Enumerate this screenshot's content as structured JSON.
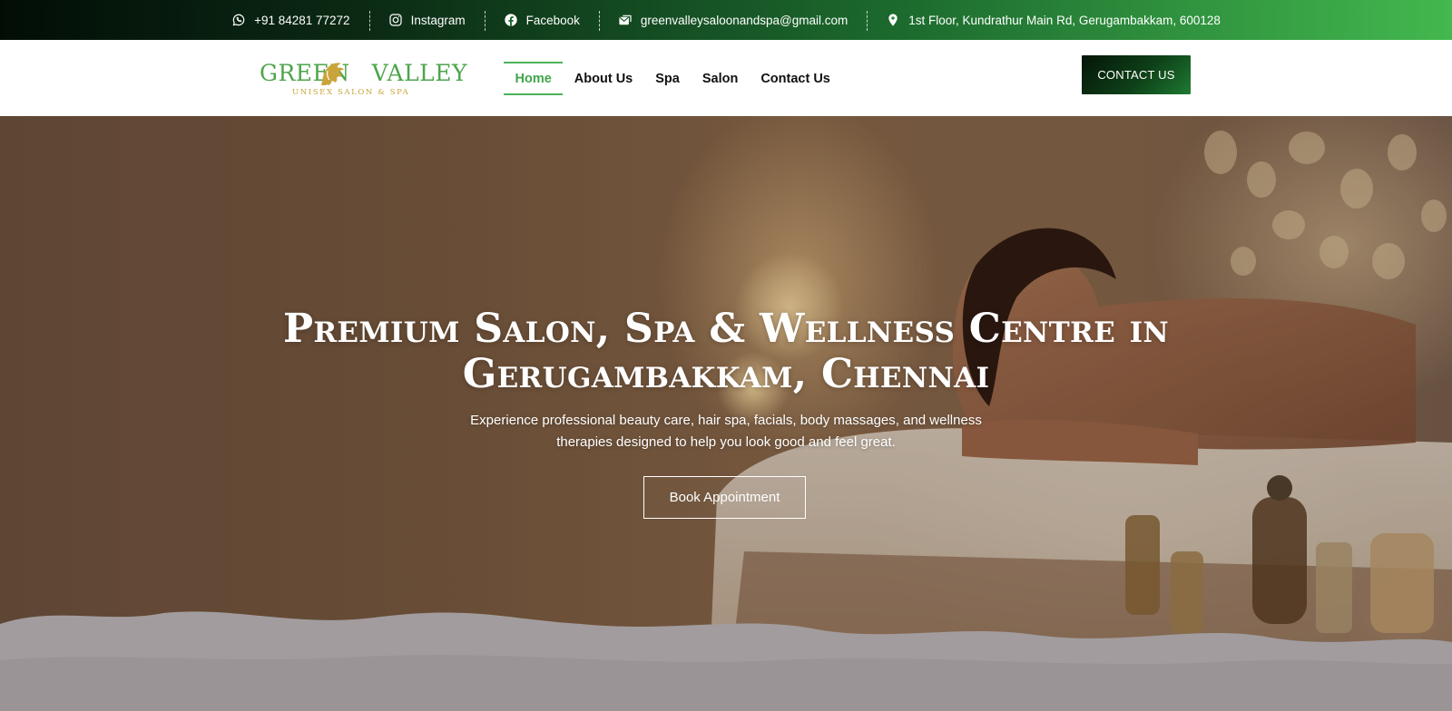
{
  "topbar": {
    "items": [
      {
        "icon": "whatsapp-icon",
        "text": "+91 84281 77272"
      },
      {
        "icon": "instagram-icon",
        "text": "Instagram"
      },
      {
        "icon": "facebook-icon",
        "text": "Facebook"
      },
      {
        "icon": "mail-icon",
        "text": "greenvalleysaloonandspa@gmail.com"
      },
      {
        "icon": "location-pin-icon",
        "text": "1st Floor, Kundrathur Main Rd, Gerugambakkam, 600128"
      }
    ]
  },
  "logo": {
    "brand": "GREEN VALLEY",
    "tagline": "UNISEX SALON & SPA",
    "green": "#4ea54b",
    "gold": "#c9a43a"
  },
  "nav": {
    "items": [
      "Home",
      "About Us",
      "Spa",
      "Salon",
      "Contact Us"
    ],
    "active": "Home",
    "active_color": "#3fa64a"
  },
  "header_cta": {
    "label": "CONTACT US"
  },
  "hero": {
    "title": "Premium Salon, Spa & Wellness Centre in Gerugambakkam, Chennai",
    "subtitle": "Experience professional beauty care, hair spa, facials, body massages, and wellness therapies designed to help you look good and feel great.",
    "button": "Book Appointment"
  }
}
